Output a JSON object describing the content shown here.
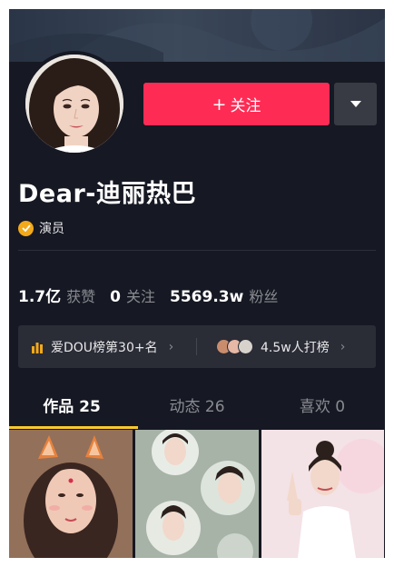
{
  "profile": {
    "name": "Dear-迪丽热巴",
    "verify_label": "演员"
  },
  "actions": {
    "follow_plus": "+",
    "follow_label": "关注"
  },
  "stats": [
    {
      "value": "1.7亿",
      "label": "获赞"
    },
    {
      "value": "0",
      "label": "关注"
    },
    {
      "value": "5569.3w",
      "label": "粉丝"
    }
  ],
  "rank": {
    "left_text": "爱DOU榜第30+名",
    "right_text": "4.5w人打榜",
    "chevron": "›"
  },
  "tabs": [
    {
      "label": "作品 25",
      "active": true
    },
    {
      "label": "动态 26",
      "active": false
    },
    {
      "label": "喜欢 0",
      "active": false
    }
  ],
  "colors": {
    "background": "#161823",
    "follow_button": "#fe2c55",
    "verify_badge": "#f2a91a",
    "tab_indicator": "#fac92b",
    "rank_icon": "#f2a91a"
  },
  "icons": [
    "bar-chart-icon",
    "chevron-right-icon",
    "caret-down-icon",
    "check-icon"
  ]
}
